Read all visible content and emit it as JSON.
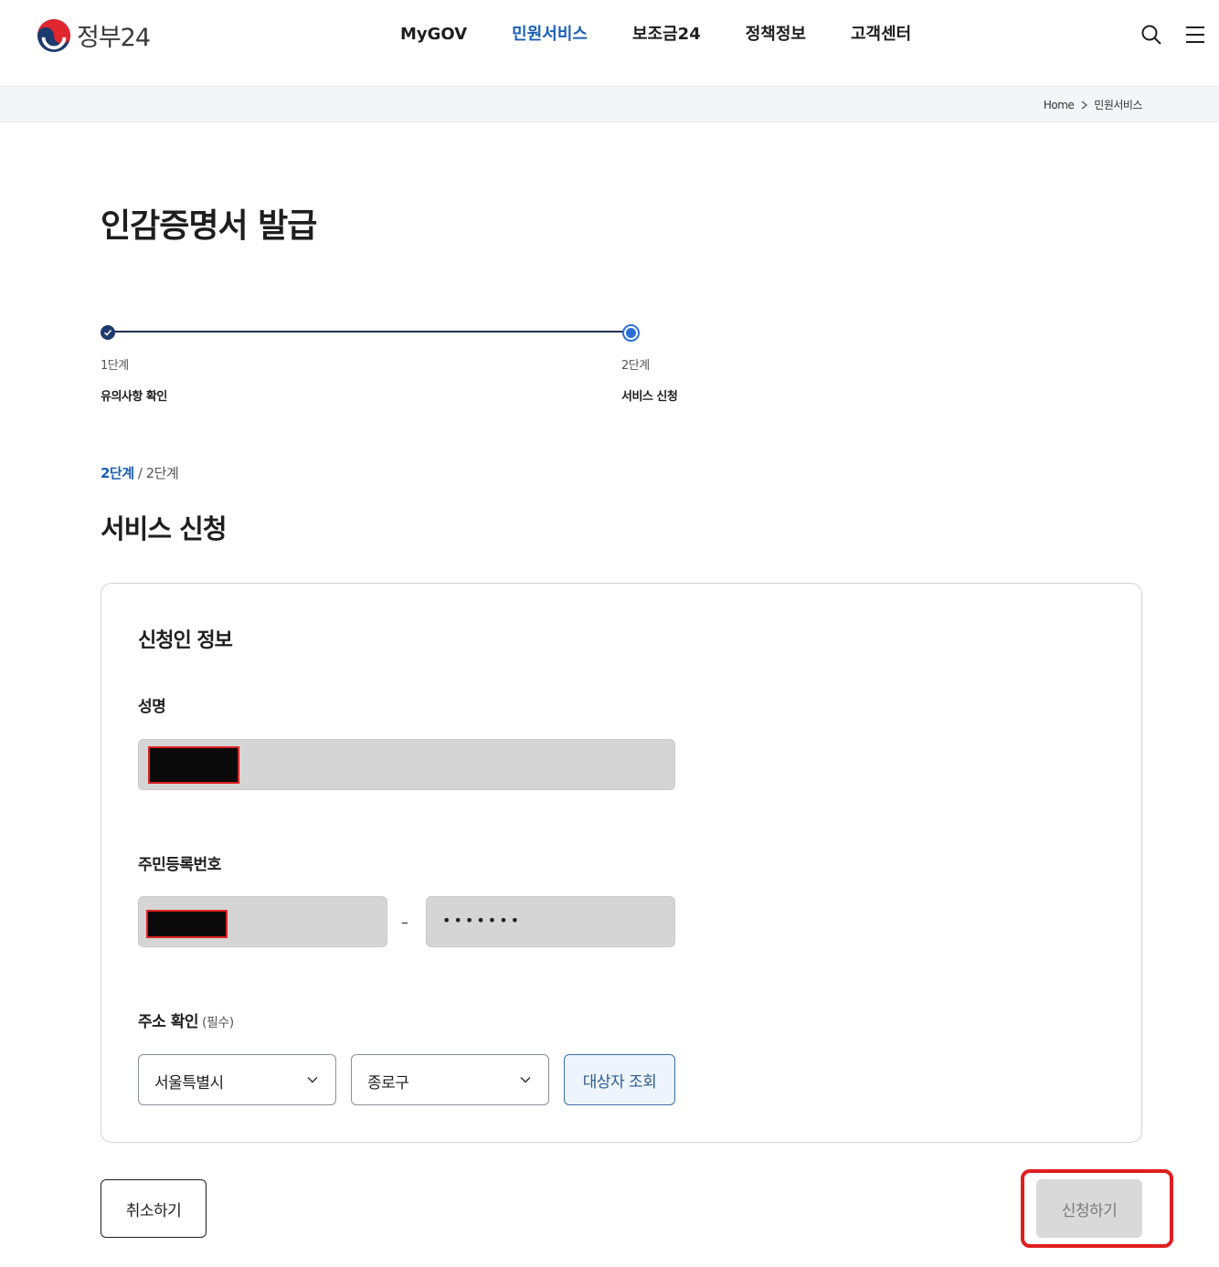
{
  "header": {
    "logo_text": "정부24",
    "nav": [
      "MyGOV",
      "민원서비스",
      "보조금24",
      "정책정보",
      "고객센터"
    ],
    "active_nav": "민원서비스"
  },
  "breadcrumb": [
    "Home",
    "민원서비스"
  ],
  "page_title": "인감증명서 발급",
  "stepper": {
    "steps": [
      {
        "num": "1단계",
        "name": "유의사항 확인",
        "status": "done"
      },
      {
        "num": "2단계",
        "name": "서비스 신청",
        "status": "current"
      }
    ]
  },
  "step_indicator": {
    "current": "2단계",
    "separator": " / ",
    "total": "2단계"
  },
  "section_title": "서비스 신청",
  "applicant": {
    "card_title": "신청인 정보",
    "name_label": "성명",
    "rrn_label": "주민등록번호",
    "rrn_dash": "–",
    "rrn_back_masked": "•••••••",
    "address_label": "주소 확인",
    "address_required": "(필수)",
    "city_value": "서울특별시",
    "district_value": "종로구",
    "lookup_button": "대상자 조회"
  },
  "actions": {
    "cancel": "취소하기",
    "submit": "신청하기"
  },
  "colors": {
    "accent": "#1a5fb4",
    "highlight_border": "#e01e1e",
    "redaction": "#0a0a0a"
  }
}
